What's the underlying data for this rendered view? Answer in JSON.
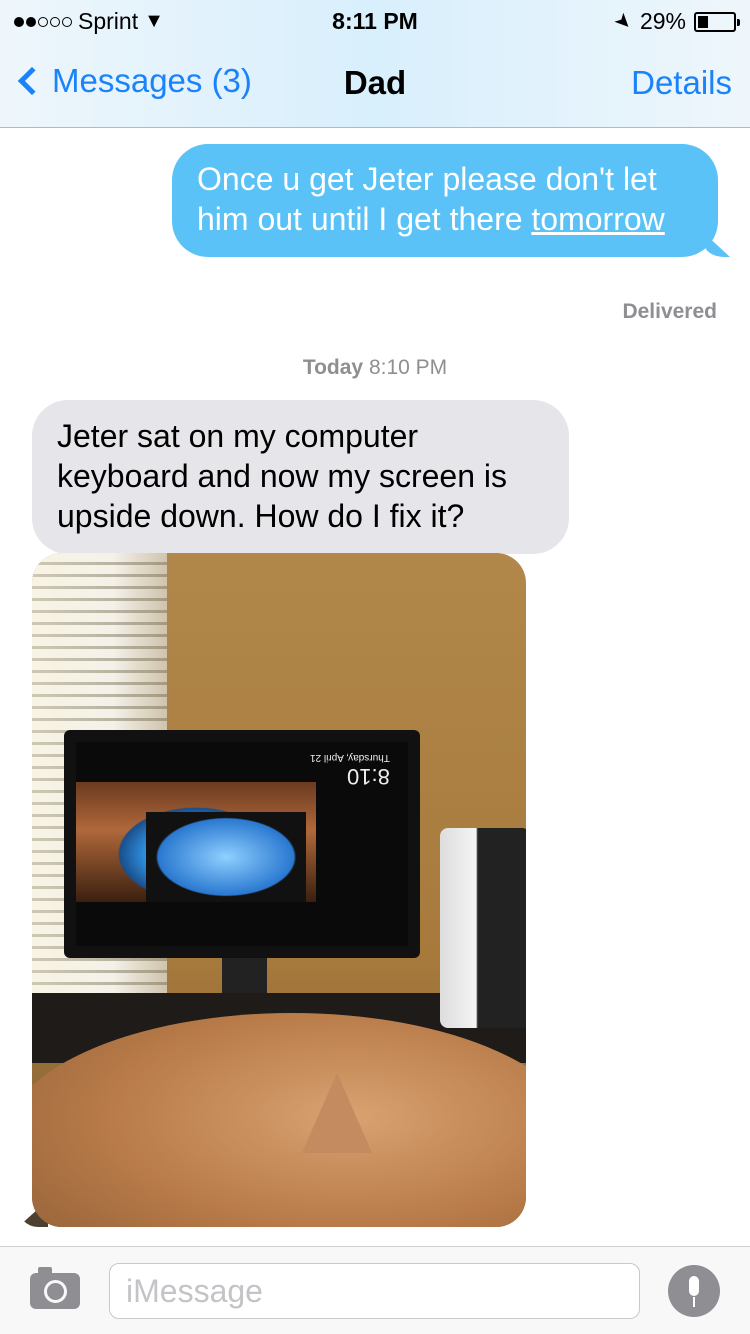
{
  "status_bar": {
    "carrier": "Sprint",
    "signal_bars": 2,
    "signal_total": 5,
    "time": "8:11 PM",
    "battery": "29%",
    "battery_level": 0.29
  },
  "nav": {
    "back_label": "Messages (3)",
    "title": "Dad",
    "details_label": "Details"
  },
  "conversation": {
    "sent_message": {
      "text": "Once u get Jeter please don't let him out until I get there ",
      "link_text": "tomorrow",
      "status": "Delivered"
    },
    "timestamp": {
      "day": "Today",
      "time": "8:10 PM"
    },
    "received_message": {
      "text": "Jeter sat on my computer keyboard and now my screen is upside down. How do I fix it?"
    },
    "photo": {
      "screen_time": "8:10",
      "screen_date": "Thursday, April 21"
    }
  },
  "composer": {
    "placeholder": "iMessage"
  },
  "colors": {
    "accent": "#1a82fb",
    "sent_bubble": "#5ac2f7",
    "received_bubble": "#e5e5ea"
  }
}
